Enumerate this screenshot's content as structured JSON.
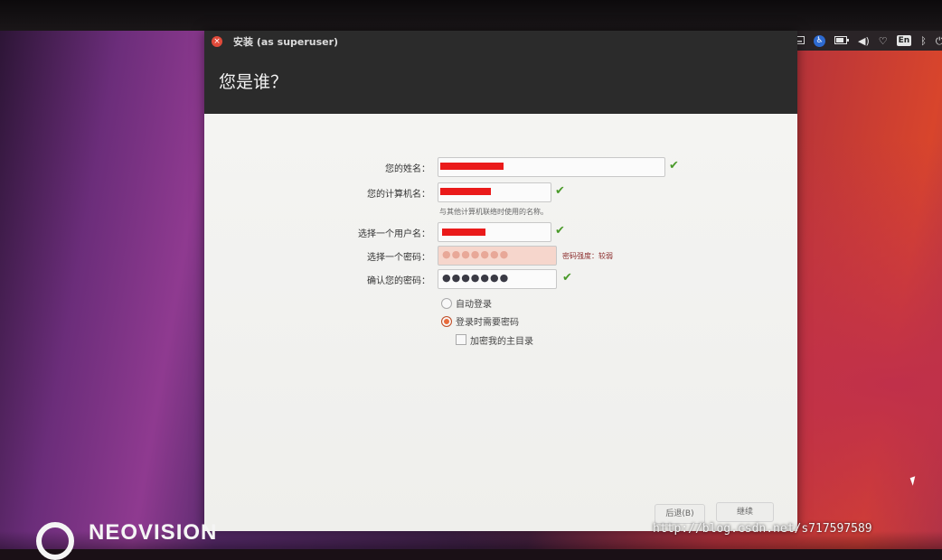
{
  "window": {
    "title": "安装 (as superuser)",
    "close_glyph": "×"
  },
  "page": {
    "title": "您是谁？"
  },
  "form": {
    "name_label": "您的姓名：",
    "computer_label": "您的计算机名：",
    "computer_hint": "与其他计算机联络时使用的名称。",
    "username_label": "选择一个用户名：",
    "password_label": "选择一个密码：",
    "password_dots": "●●●●●●●",
    "password_strength": "密码强度：较弱",
    "confirm_label": "确认您的密码：",
    "confirm_dots": "●●●●●●●",
    "check_glyph": "✔",
    "auto_login_label": "自动登录",
    "require_password_label": "登录时需要密码",
    "require_password_selected": true,
    "encrypt_home_label": "加密我的主目录"
  },
  "buttons": {
    "back_label": "后退(B)",
    "continue_label": "继续"
  },
  "top_panel": {
    "keyboard_icon": "keyboard-icon",
    "accessibility_glyph": "♿",
    "battery_icon": "battery-icon",
    "volume_glyph": "◀)",
    "wifi_glyph": "♡",
    "lang_label": "En",
    "bluetooth_glyph": "ᛒ",
    "power_glyph": "⏻"
  },
  "overlay": {
    "brand_text": "NEOVISION",
    "url_watermark": "http://blog.csdn.net/s717597589"
  },
  "colors": {
    "accent": "#e86a3a",
    "ok_check": "#4a9a2a",
    "redaction": "#ea1a1a"
  }
}
